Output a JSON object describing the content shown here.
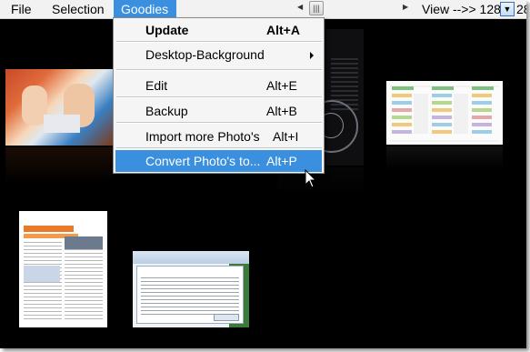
{
  "menubar": {
    "file": "File",
    "selection": "Selection",
    "goodies": "Goodies"
  },
  "toolbar": {
    "view_label": "View -->> 128 x",
    "view_tail": "28",
    "scroll_thumb_glyph": "|||",
    "scroll_left_glyph": "◀",
    "scroll_right_glyph": "▶",
    "combo_glyph": "▼"
  },
  "goodies_menu": {
    "items": [
      {
        "label": "Update",
        "shortcut": "Alt+A"
      },
      {
        "label": "Desktop-Background",
        "shortcut": ""
      },
      {
        "label": "Edit",
        "shortcut": "Alt+E"
      },
      {
        "label": "Backup",
        "shortcut": "Alt+B"
      },
      {
        "label": "Import more Photo's",
        "shortcut": "Alt+I"
      },
      {
        "label": "Convert Photo's to...",
        "shortcut": "Alt+P"
      }
    ],
    "highlight_color": "#3a8fde"
  },
  "gallery": {
    "thumbnails": [
      {
        "name": "baby-photo"
      },
      {
        "name": "dark-magazine-page"
      },
      {
        "name": "calendar-spreadsheet"
      },
      {
        "name": "spotlight-article"
      },
      {
        "name": "dialog-screenshot"
      }
    ]
  },
  "colors": {
    "background": "#000000",
    "accent": "#3a8fde"
  }
}
